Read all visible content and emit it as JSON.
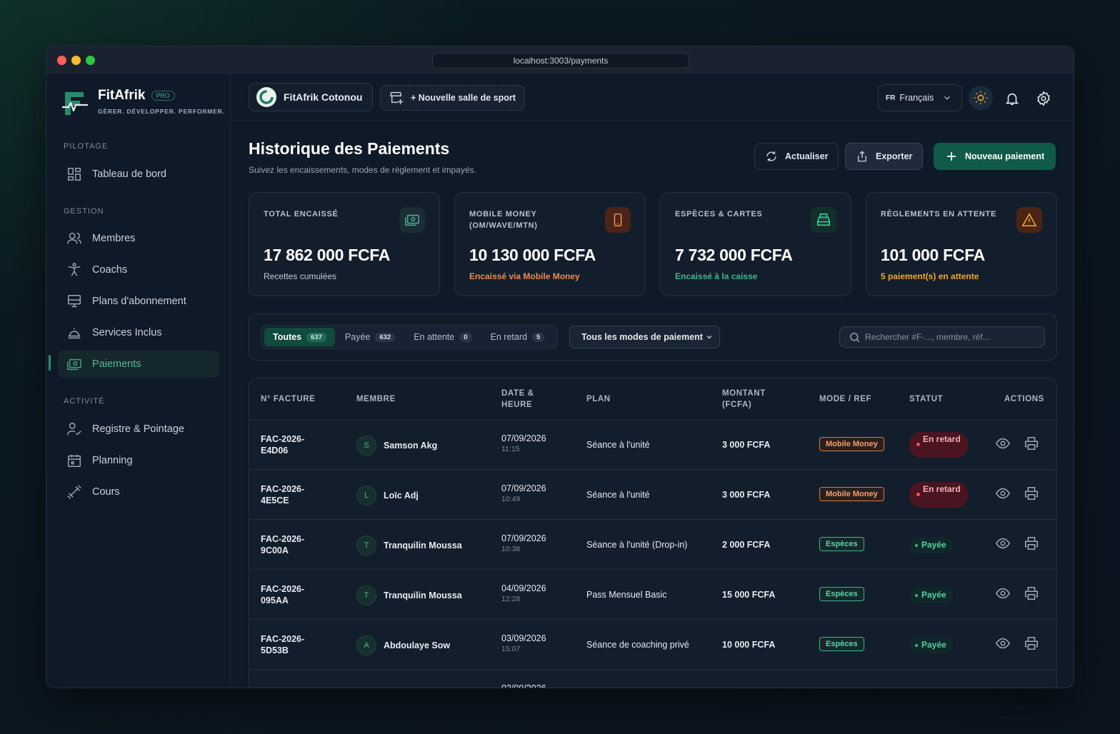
{
  "browser": {
    "url": "localhost:3003/payments"
  },
  "brand": {
    "name": "FitAfrik",
    "badge": "PRO",
    "tagline": "GÉRER. DÉVELOPPER. PERFORMER."
  },
  "sidebar": {
    "sections": [
      {
        "title": "PILOTAGE",
        "items": [
          {
            "label": "Tableau de bord",
            "icon": "dashboard-icon"
          }
        ]
      },
      {
        "title": "GESTION",
        "items": [
          {
            "label": "Membres",
            "icon": "users-icon"
          },
          {
            "label": "Coachs",
            "icon": "coach-icon"
          },
          {
            "label": "Plans d'abonnement",
            "icon": "plans-icon"
          },
          {
            "label": "Services Inclus",
            "icon": "cloche-icon"
          },
          {
            "label": "Paiements",
            "icon": "cash-icon",
            "active": true
          }
        ]
      },
      {
        "title": "ACTIVITÉ",
        "items": [
          {
            "label": "Registre & Pointage",
            "icon": "user-check-icon"
          },
          {
            "label": "Planning",
            "icon": "calendar-icon"
          },
          {
            "label": "Cours",
            "icon": "dumbbell-icon"
          }
        ]
      }
    ]
  },
  "topbar": {
    "gym_name": "FitAfrik Cotonou",
    "new_gym": "+ Nouvelle salle de sport",
    "lang_code": "FR",
    "lang_label": "Français"
  },
  "page": {
    "title": "Historique des Paiements",
    "subtitle": "Suivez les encaissements, modes de règlement et impayés.",
    "refresh": "Actualiser",
    "export": "Exporter",
    "new_payment": "Nouveau paiement"
  },
  "stats": [
    {
      "label": "TOTAL ENCAISSÉ",
      "value": "17 862 000 FCFA",
      "sub": "Recettes cumulées",
      "accent": "#9aa7b4",
      "icon": "money-icon"
    },
    {
      "label": "MOBILE MONEY (OM/WAVE/MTN)",
      "value": "10 130 000 FCFA",
      "sub": "Encaissé via Mobile Money",
      "accent": "#f08a4b",
      "icon": "phone-icon"
    },
    {
      "label": "ESPÈCES & CARTES",
      "value": "7 732 000 FCFA",
      "sub": "Encaissé à la caisse",
      "accent": "#3fb58e",
      "icon": "register-icon"
    },
    {
      "label": "RÈGLEMENTS EN ATTENTE",
      "value": "101 000 FCFA",
      "sub": "5 paiement(s) en attente",
      "accent": "#f5a524",
      "icon": "warning-icon"
    }
  ],
  "filters": {
    "tabs": [
      {
        "label": "Toutes",
        "count": "637",
        "active": true
      },
      {
        "label": "Payée",
        "count": "632"
      },
      {
        "label": "En attente",
        "count": "0"
      },
      {
        "label": "En retard",
        "count": "5"
      }
    ],
    "mode_select": "Tous les modes de paiement",
    "search_placeholder": "Rechercher #F-..., membre, réf..."
  },
  "table": {
    "headers": {
      "invoice": "N° FACTURE",
      "member": "MEMBRE",
      "date": "DATE & HEURE",
      "plan": "PLAN",
      "amount": "MONTANT (FCFA)",
      "mode": "MODE / REF",
      "status": "STATUT",
      "actions": "ACTIONS"
    },
    "rows": [
      {
        "invoice": "FAC-2026-E4D06",
        "initial": "S",
        "member": "Samson Akg",
        "date": "07/09/2026",
        "time": "11:15",
        "plan": "Séance à l'unité",
        "amount": "3 000 FCFA",
        "mode": "Mobile Money",
        "mode_type": "mm",
        "status": "En retard",
        "status_type": "late"
      },
      {
        "invoice": "FAC-2026-4E5CE",
        "initial": "L",
        "member": "Loïc Adj",
        "date": "07/09/2026",
        "time": "10:49",
        "plan": "Séance à l'unité",
        "amount": "3 000 FCFA",
        "mode": "Mobile Money",
        "mode_type": "mm",
        "status": "En retard",
        "status_type": "late"
      },
      {
        "invoice": "FAC-2026-9C00A",
        "initial": "T",
        "member": "Tranquilin Moussa",
        "date": "07/09/2026",
        "time": "10:38",
        "plan": "Séance à l'unité (Drop-in)",
        "amount": "2 000 FCFA",
        "mode": "Espèces",
        "mode_type": "esp",
        "status": "Payée",
        "status_type": "paid"
      },
      {
        "invoice": "FAC-2026-095AA",
        "initial": "T",
        "member": "Tranquilin Moussa",
        "date": "04/09/2026",
        "time": "12:28",
        "plan": "Pass Mensuel Basic",
        "amount": "15 000 FCFA",
        "mode": "Espèces",
        "mode_type": "esp",
        "status": "Payée",
        "status_type": "paid"
      },
      {
        "invoice": "FAC-2026-5D53B",
        "initial": "A",
        "member": "Abdoulaye Sow",
        "date": "03/09/2026",
        "time": "15:07",
        "plan": "Séance de coaching privé",
        "amount": "10 000 FCFA",
        "mode": "Espèces",
        "mode_type": "esp",
        "status": "Payée",
        "status_type": "paid"
      },
      {
        "invoice": "",
        "initial": "",
        "member": "",
        "date": "03/09/2026",
        "time": "",
        "plan": "",
        "amount": "",
        "mode": "",
        "mode_type": "esp",
        "status": "",
        "status_type": "paid"
      }
    ]
  }
}
